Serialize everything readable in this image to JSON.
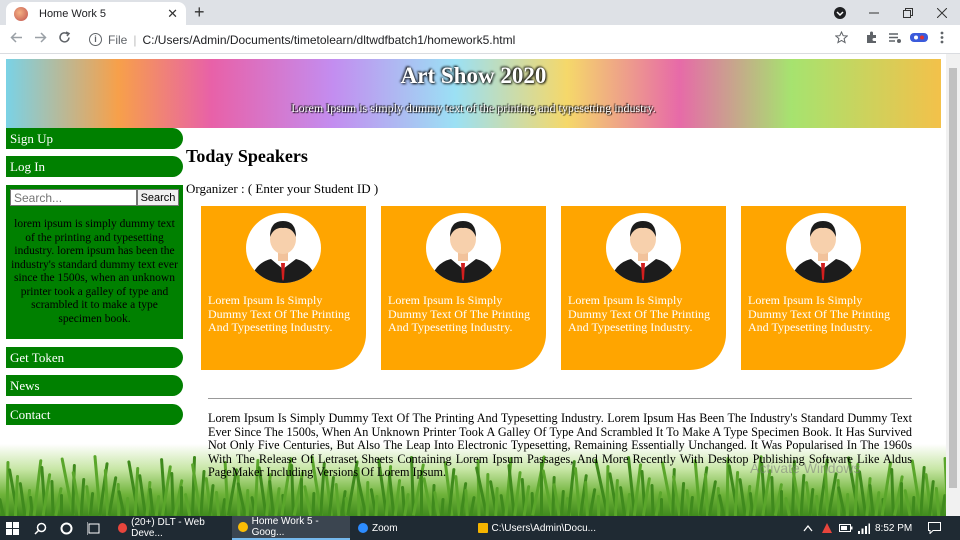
{
  "browser": {
    "tab_title": "Home Work 5",
    "tab_close": "✕",
    "new_tab": "+",
    "address_prefix": "File",
    "address_separator": "|",
    "url": "C:/Users/Admin/Documents/timetolearn/dltwdfbatch1/homework5.html"
  },
  "banner": {
    "title": "Art Show 2020",
    "subtitle": "Lorem Ipsum is simply dummy text of the printing and typesetting industry."
  },
  "sidebar": {
    "top_buttons": [
      "Sign Up",
      "Log In"
    ],
    "search": {
      "placeholder": "Search...",
      "button": "Search"
    },
    "blurb": "lorem ipsum is simply dummy text of the printing and typesetting industry. lorem ipsum has been the industry's standard dummy text ever since the 1500s, when an unknown printer took a galley of type and scrambled it to make a type specimen book.",
    "bottom_buttons": [
      "Get Token",
      "News",
      "Contact"
    ]
  },
  "main": {
    "heading": "Today Speakers",
    "organizer": "Organizer : ( Enter your Student ID )",
    "cards": [
      {
        "text": "Lorem Ipsum Is Simply Dummy Text Of The Printing And Typesetting Industry."
      },
      {
        "text": "Lorem Ipsum Is Simply Dummy Text Of The Printing And Typesetting Industry."
      },
      {
        "text": "Lorem Ipsum Is Simply Dummy Text Of The Printing And Typesetting Industry."
      },
      {
        "text": "Lorem Ipsum Is Simply Dummy Text Of The Printing And Typesetting Industry."
      }
    ],
    "paragraph": "Lorem Ipsum Is Simply Dummy Text Of The Printing And Typesetting Industry. Lorem Ipsum Has Been The Industry's Standard Dummy Text Ever Since The 1500s, When An Unknown Printer Took A Galley Of Type And Scrambled It To Make A Type Specimen Book. It Has Survived Not Only Five Centuries, But Also The Leap Into Electronic Typesetting, Remaining Essentially Unchanged. It Was Popularised In The 1960s With The Release Of Letraset Sheets Containing Lorem Ipsum Passages, And More Recently With Desktop Publishing Software Like Aldus PageMaker Including Versions Of Lorem Ipsum."
  },
  "watermark": "Activate Windows",
  "taskbar": {
    "apps": [
      {
        "label": "(20+) DLT - Web Deve...",
        "color": "#e8453c"
      },
      {
        "label": "Home Work 5 - Goog...",
        "color": "#fbbc05"
      },
      {
        "label": "Zoom",
        "color": "#2d8cff"
      },
      {
        "label": "C:\\Users\\Admin\\Docu...",
        "color": "#f5b400"
      }
    ],
    "clock": "8:52 PM"
  },
  "colors": {
    "accent_green": "#008000",
    "card_orange": "#ffa500"
  }
}
